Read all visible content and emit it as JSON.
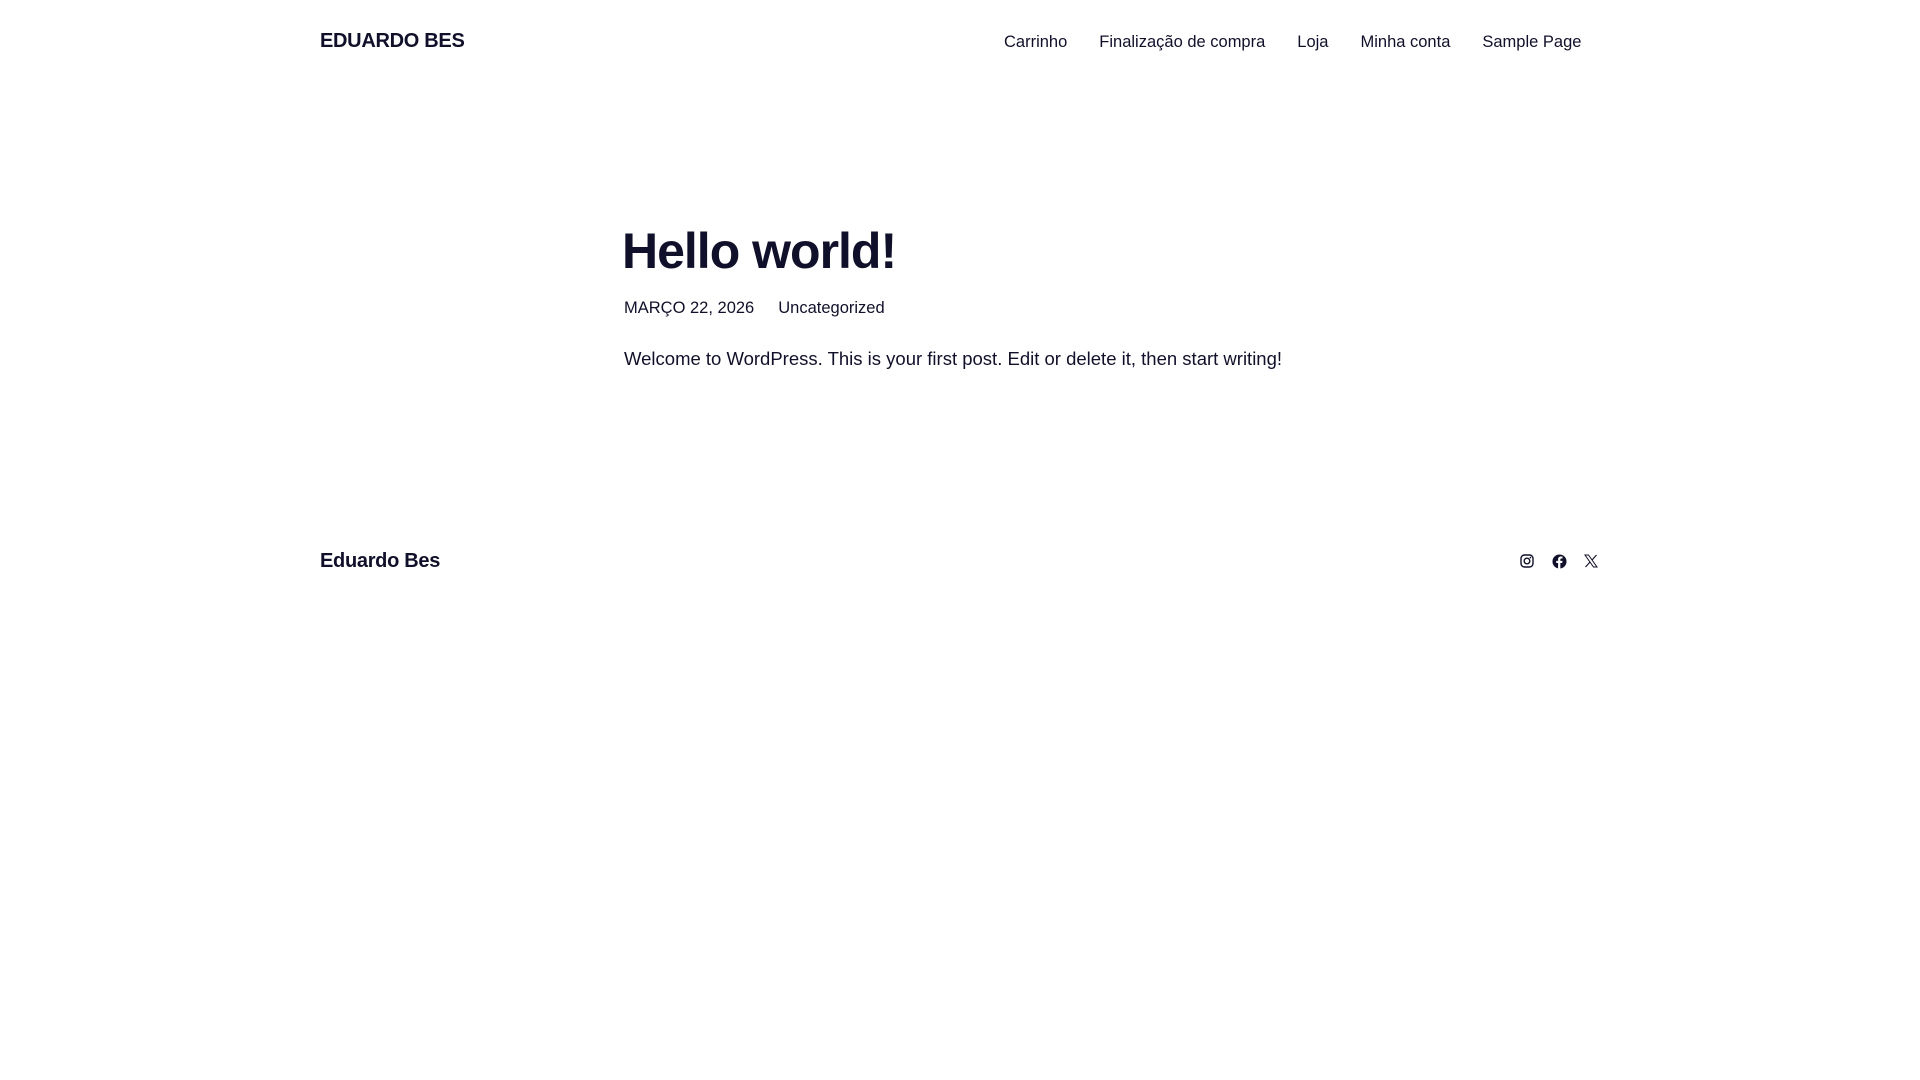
{
  "header": {
    "site_title": "EDUARDO BES",
    "nav": [
      "Carrinho",
      "Finalização de compra",
      "Loja",
      "Minha conta",
      "Sample Page"
    ]
  },
  "post": {
    "title": "Hello world!",
    "date": "MARÇO 22, 2026",
    "category": "Uncategorized",
    "content": "Welcome to WordPress. This is your first post. Edit or delete it, then start writing!"
  },
  "footer": {
    "site_title": "Eduardo Bes",
    "social_icons": [
      "instagram-icon",
      "facebook-icon",
      "x-icon"
    ]
  }
}
